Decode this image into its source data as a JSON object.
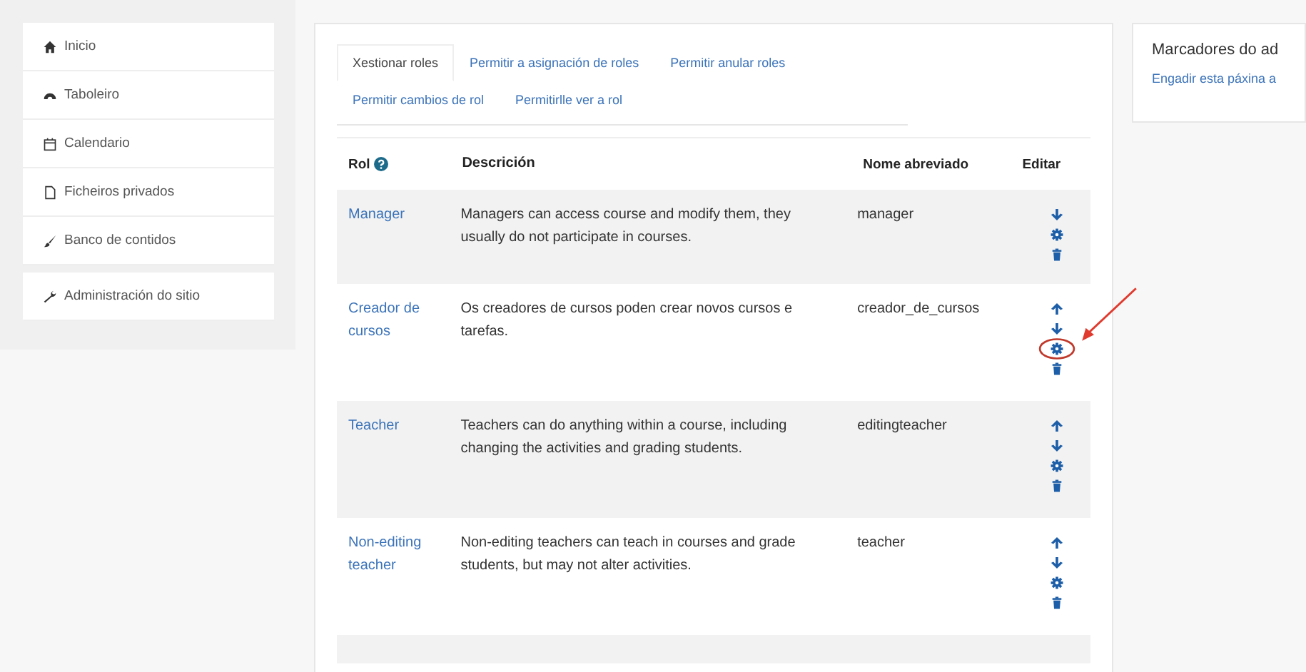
{
  "sidebar": {
    "items": [
      {
        "label": "Inicio"
      },
      {
        "label": "Taboleiro"
      },
      {
        "label": "Calendario"
      },
      {
        "label": "Ficheiros privados"
      },
      {
        "label": "Banco de contidos"
      },
      {
        "label": "Administración do sitio"
      }
    ]
  },
  "tabs": [
    {
      "label": "Xestionar roles",
      "selected": true
    },
    {
      "label": "Permitir a asignación de roles",
      "selected": false
    },
    {
      "label": "Permitir anular roles",
      "selected": false
    },
    {
      "label": "Permitir cambios de rol",
      "selected": false
    },
    {
      "label": "Permitirlle ver a rol",
      "selected": false
    }
  ],
  "table": {
    "columns": [
      "Rol",
      "Descrición",
      "Nome abreviado",
      "Editar"
    ],
    "rows": [
      {
        "role": "Manager",
        "description": "Managers can access course and modify them, they usually do not participate in courses.",
        "shortname": "manager",
        "annotated": false
      },
      {
        "role": "Creador de cursos",
        "description": "Os creadores de cursos poden crear novos cursos e tarefas.",
        "shortname": "creador_de_cursos",
        "annotated": true
      },
      {
        "role": "Teacher",
        "description": "Teachers can do anything within a course, including changing the activities and grading students.",
        "shortname": "editingteacher",
        "annotated": false
      },
      {
        "role": "Non-editing teacher",
        "description": "Non-editing teachers can teach in courses and grade students, but may not alter activities.",
        "shortname": "teacher",
        "annotated": false
      }
    ]
  },
  "bookmarks": {
    "title": "Marcadores do ad",
    "link": "Engadir esta páxina a"
  }
}
